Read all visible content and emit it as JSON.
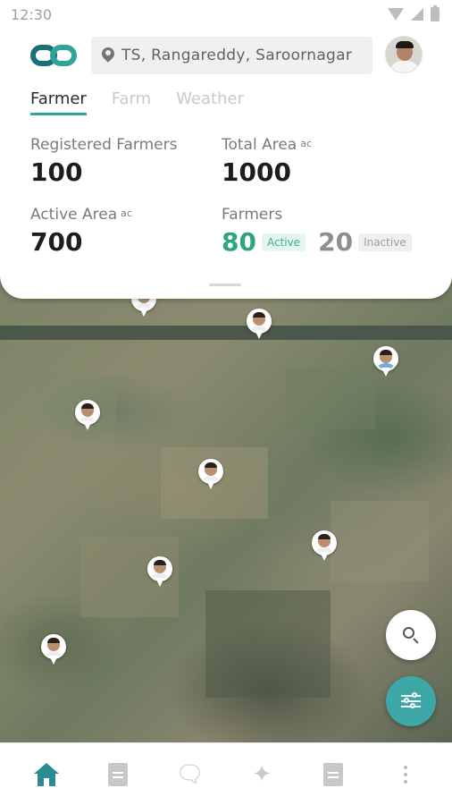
{
  "status_bar": {
    "time": "12:30"
  },
  "header": {
    "location": "TS, Rangareddy, Saroornagar"
  },
  "tabs": [
    {
      "label": "Farmer",
      "active": true
    },
    {
      "label": "Farm",
      "active": false
    },
    {
      "label": "Weather",
      "active": false
    }
  ],
  "stats": {
    "registered_farmers": {
      "label": "Registered Farmers",
      "value": "100"
    },
    "total_area": {
      "label": "Total Area",
      "unit": "ac",
      "value": "1000"
    },
    "active_area": {
      "label": "Active Area",
      "unit": "ac",
      "value": "700"
    },
    "farmers": {
      "label": "Farmers",
      "active_count": "80",
      "active_label": "Active",
      "inactive_count": "20",
      "inactive_label": "Inactive"
    }
  },
  "map_pins_count_visible": 8,
  "colors": {
    "accent": "#2ea596",
    "active_green": "#2ea57a",
    "fab_filter": "#3ea7a8",
    "nav_active": "#2a8d91"
  },
  "bottom_nav": [
    {
      "icon": "home-icon",
      "active": true
    },
    {
      "icon": "edit-document-icon",
      "active": false
    },
    {
      "icon": "chat-icon",
      "active": false
    },
    {
      "icon": "satellite-icon",
      "active": false
    },
    {
      "icon": "document-icon",
      "active": false
    },
    {
      "icon": "more-vertical-icon",
      "active": false
    }
  ]
}
